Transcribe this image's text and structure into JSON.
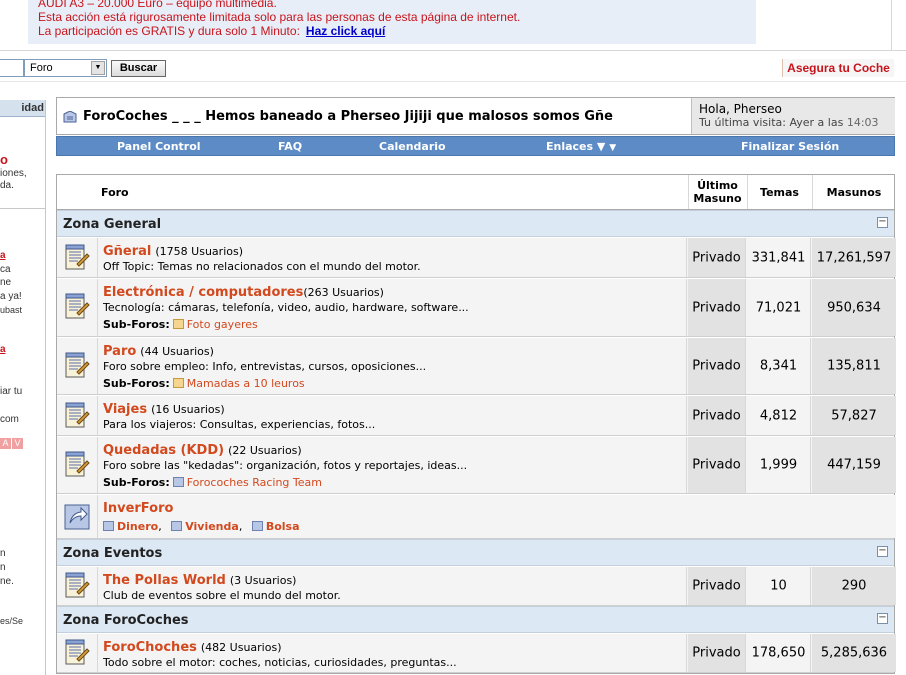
{
  "banner": {
    "line0": "AUDI A3   –   20.000 Euro   –   equipo multimedia.",
    "line1": "Esta acción está rigurosamente limitada solo para las personas de esta página de internet.",
    "line2": "La participación es GRATIS y dura solo 1 Minuto:",
    "link": "Haz click aquí"
  },
  "search": {
    "select_value": "Foro",
    "button": "Buscar"
  },
  "ad_right": "Asegura tu Coche",
  "sidebar": {
    "head": "idad",
    "t1": "o",
    "t2": "iones,",
    "t3": "da.",
    "t4": "a",
    "t5": "ca",
    "t6": "ne",
    "t7": "a ya!",
    "t8": "ubast",
    "t9": "a",
    "t10": "iar tu",
    "t11": "com",
    "t12": "n",
    "t13": "n",
    "t14": "ne.",
    "t15": "es/Se",
    "tag_a": "A",
    "tag_v": "V"
  },
  "header": {
    "title": "ForoCoches _ _ _ Hemos baneado a Pherseo Jijiji que malosos somos Gñe",
    "greeting": "Hola, Pherseo",
    "last_visit": "Tu última visita: Ayer a las",
    "last_visit_time": "14:03"
  },
  "navbar": {
    "panel": "Panel Control",
    "faq": "FAQ",
    "calendar": "Calendario",
    "links": "Enlaces ▼",
    "logout": "Finalizar Sesión"
  },
  "table": {
    "col_foro": "Foro",
    "col_last_1": "Último",
    "col_last_2": "Masuno",
    "col_temas": "Temas",
    "col_masunos": "Masunos",
    "collapse": "−",
    "zones": [
      {
        "title": "Zona General",
        "forums": [
          {
            "name": "Gñeral",
            "users": "(1758 Usuarios)",
            "desc": "Off Topic: Temas no relacionados con el mundo del motor.",
            "last": "Privado",
            "temas": "331,841",
            "masunos": "17,261,597"
          },
          {
            "name": "Electrónica / computadores",
            "users": "(263 Usuarios)",
            "desc": "Tecnología: cámaras, telefonía, video, audio, hardware, software...",
            "sub_label": "Sub-Foros:",
            "sub_link": "Foto gayeres",
            "last": "Privado",
            "temas": "71,021",
            "masunos": "950,634"
          },
          {
            "name": "Paro",
            "users": "(44 Usuarios)",
            "desc": "Foro sobre empleo: Info, entrevistas, cursos, oposiciones...",
            "sub_label": "Sub-Foros:",
            "sub_link": "Mamadas a 10 leuros",
            "last": "Privado",
            "temas": "8,341",
            "masunos": "135,811"
          },
          {
            "name": "Viajes",
            "users": "(16 Usuarios)",
            "desc": "Para los viajeros: Consultas, experiencias, fotos...",
            "last": "Privado",
            "temas": "4,812",
            "masunos": "57,827"
          },
          {
            "name": "Quedadas (KDD)",
            "users": "(22 Usuarios)",
            "desc": "Foro sobre las \"kedadas\": organización, fotos y reportajes, ideas...",
            "sub_label": "Sub-Foros:",
            "sub_link": "Forocoches Racing Team",
            "last": "Privado",
            "temas": "1,999",
            "masunos": "447,159"
          },
          {
            "name": "InverForo",
            "links": [
              "Dinero",
              "Vivienda",
              "Bolsa"
            ]
          }
        ]
      },
      {
        "title": "Zona Eventos",
        "forums": [
          {
            "name": "The Pollas World",
            "users": "(3 Usuarios)",
            "desc": "Club de eventos sobre el mundo del motor.",
            "last": "Privado",
            "temas": "10",
            "masunos": "290"
          }
        ]
      },
      {
        "title": "Zona ForoCoches",
        "forums": [
          {
            "name": "ForoChoches",
            "users": "(482 Usuarios)",
            "desc": "Todo sobre el motor: coches, noticias, curiosidades, preguntas...",
            "last": "Privado",
            "temas": "178,650",
            "masunos": "5,285,636"
          }
        ]
      }
    ]
  },
  "colors": {
    "forum_link": "#d2491e",
    "navbar": "#5c8bc6",
    "zone_bg": "#dce8f4",
    "banner_text": "#c8141c"
  }
}
